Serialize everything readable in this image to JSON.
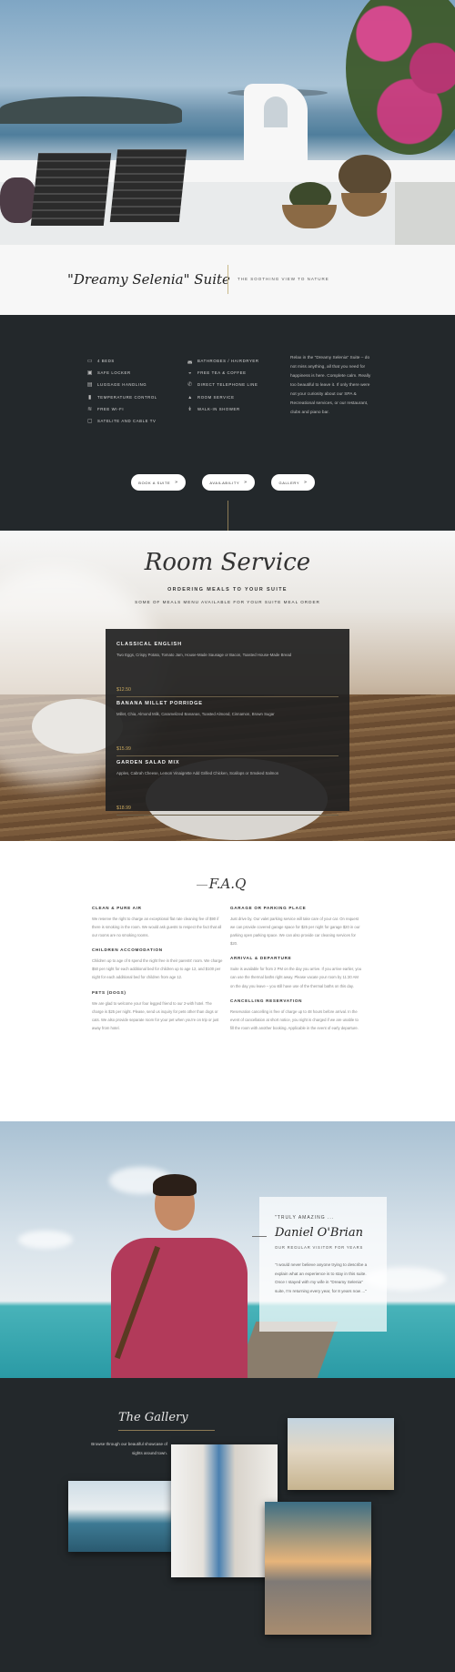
{
  "header": {
    "title": "\"Dreamy Selenia\" Suite",
    "tagline": "THE SOOTHING VIEW TO NATURE"
  },
  "amenities": {
    "left": [
      {
        "icon": "bed-icon",
        "glyph": "▭",
        "label": "4 BEDS"
      },
      {
        "icon": "lock-icon",
        "glyph": "▣",
        "label": "SAFE LOCKER"
      },
      {
        "icon": "luggage-icon",
        "glyph": "▤",
        "label": "LUGGAGE HANDLING"
      },
      {
        "icon": "thermometer-icon",
        "glyph": "▮",
        "label": "TEMPERATURE CONTROL"
      },
      {
        "icon": "wifi-icon",
        "glyph": "≋",
        "label": "FREE WI-FI"
      },
      {
        "icon": "tv-icon",
        "glyph": "▢",
        "label": "SATELITE AND CABLE TV"
      }
    ],
    "right": [
      {
        "icon": "bath-icon",
        "glyph": "◛",
        "label": "BATHROBES / HAIRDRYER"
      },
      {
        "icon": "coffee-icon",
        "glyph": "◒",
        "label": "FREE TEA & COFFEE"
      },
      {
        "icon": "phone-icon",
        "glyph": "✆",
        "label": "DIRECT TELEPHONE LINE"
      },
      {
        "icon": "bell-icon",
        "glyph": "▴",
        "label": "ROOM SERVICE"
      },
      {
        "icon": "shower-icon",
        "glyph": "↡",
        "label": "WALK-IN SHOWER"
      }
    ],
    "description": "Relax in the \"Dreamy Selenia\" Suite – do not miss anything, all that you need for happiness is here. Complete calm. Really too beautiful to leave it. If only there were not your curiosity about our SPA & Recreational services, or our restaurant, clubs and piano bar.",
    "buttons": {
      "book": "BOOK A SUITE",
      "availability": "AVAILABILITY",
      "gallery": "GALLERY",
      "arrow": "»"
    }
  },
  "room_service": {
    "heading": "Room Service",
    "subheading": "ORDERING MEALS TO YOUR SUITE",
    "caption": "SOME OF MEALS MENU AVAILABLE FOR YOUR SUITE MEAL ORDER",
    "items": [
      {
        "name": "CLASSICAL ENGLISH",
        "desc": "Two Eggs, Crispy Potato, Tomato Jam, House-Made Sausage or Bacon, Toasted House-Made Bread",
        "price": "$12.50"
      },
      {
        "name": "BANANA MILLET PORRIDGE",
        "desc": "Millet, Chia, Almond Milk, Caramelized Bananas, Toasted Almond, Cinnamon, Brown Sugar",
        "price": "$15.99"
      },
      {
        "name": "GARDEN SALAD MIX",
        "desc": "Apples, Cabrah Cheese, Lemon Vinaigrette Add Grilled Chicken, Scallops or Smoked Salmon",
        "price": "$18.99"
      }
    ]
  },
  "faq": {
    "title": "F.A.Q",
    "left": [
      {
        "q": "CLEAN & PURE AIR",
        "a": "We reserve the right to charge an exceptional flat rate cleaning fee of $90 if there is smoking in the room. We would ask guests to respect the fact that all our rooms are no smoking rooms."
      },
      {
        "q": "CHILDREN ACCOMODATION",
        "a": "Children up to age of 6 spend the night free in their parents' room. We charge $50 per night for each additional bed for children up to age 12, and $100 per night for each additional bed for children from age 12."
      },
      {
        "q": "PETS (DOGS)",
        "a": "We are glad to welcome your four legged friend to our 2-with hotel. The charge is $25 per night. Please, send us inquiry for pets other than dogs or cats. We also provide separate room for your pet when you're on trip or just away from hotel."
      }
    ],
    "right": [
      {
        "q": "GARAGE OR PARKING PLACE",
        "a": "Just drive by. Our valet parking service will take care of your car. On request we can provide covered garage space for $25 per night for garage $20 in our parking open parking space. We can also provide car cleaning services for $20."
      },
      {
        "q": "ARRIVAL & DEPARTURE",
        "a": "Suite is available for from 2 PM on the day you arrive. If you arrive earlier, you can use the thermal baths right away. Please vacate your room by 11:30 AM on the day you leave – you still have use of the thermal baths on this day."
      },
      {
        "q": "CANCELLING RESERVATION",
        "a": "Reservation cancelling is free of charge up to 48 hours before arrival. In the event of cancellation at short notice, you night is charged if we are unable to fill the room with another booking. Applicable in the event of early departure."
      }
    ]
  },
  "testimonial": {
    "eyebrow": "\"TRULY AMAZING ...",
    "name": "Daniel O'Brian",
    "role": "OUR REGULAR VISITOR FOR YEARS",
    "quote": "\"I would never believe anyone trying to describe a explain what an experience is to stay in this suite. Once I stayed with my wife in \"Dreamy Selenia\" suite, I'm returning every year, for 8 years now ...\""
  },
  "gallery": {
    "title": "The Gallery",
    "text": "Browse through our beautiful showcase of sights around town."
  }
}
